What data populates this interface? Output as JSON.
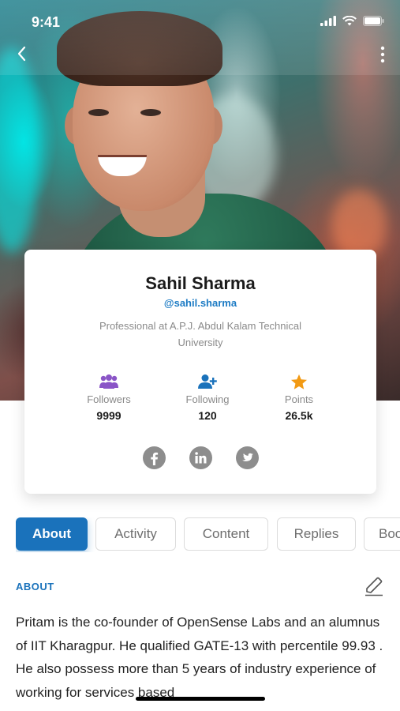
{
  "status_bar": {
    "time": "9:41"
  },
  "profile": {
    "name": "Sahil Sharma",
    "handle": "@sahil.sharma",
    "bio": "Professional at A.P.J. Abdul Kalam Technical University"
  },
  "stats": [
    {
      "label": "Followers",
      "value": "9999",
      "icon": "followers-icon",
      "color": "#8a55c7"
    },
    {
      "label": "Following",
      "value": "120",
      "icon": "add-user-icon",
      "color": "#1a72bb"
    },
    {
      "label": "Points",
      "value": "26.5k",
      "icon": "star-icon",
      "color": "#f29a14"
    }
  ],
  "socials": [
    "facebook-icon",
    "linkedin-icon",
    "twitter-icon"
  ],
  "tabs": [
    {
      "label": "About",
      "active": true
    },
    {
      "label": "Activity",
      "active": false
    },
    {
      "label": "Content",
      "active": false
    },
    {
      "label": "Replies",
      "active": false
    },
    {
      "label": "Boo",
      "active": false
    }
  ],
  "about": {
    "heading": "ABOUT",
    "text": "Pritam is the co-founder of OpenSense Labs and an alumnus of IIT Kharagpur. He qualified GATE-13 with percentile 99.93 . He also possess more than 5 years of industry experience of working for services based"
  },
  "colors": {
    "accent": "#1a72bb",
    "muted": "#8a8a8a",
    "social": "#8d8d8d"
  }
}
